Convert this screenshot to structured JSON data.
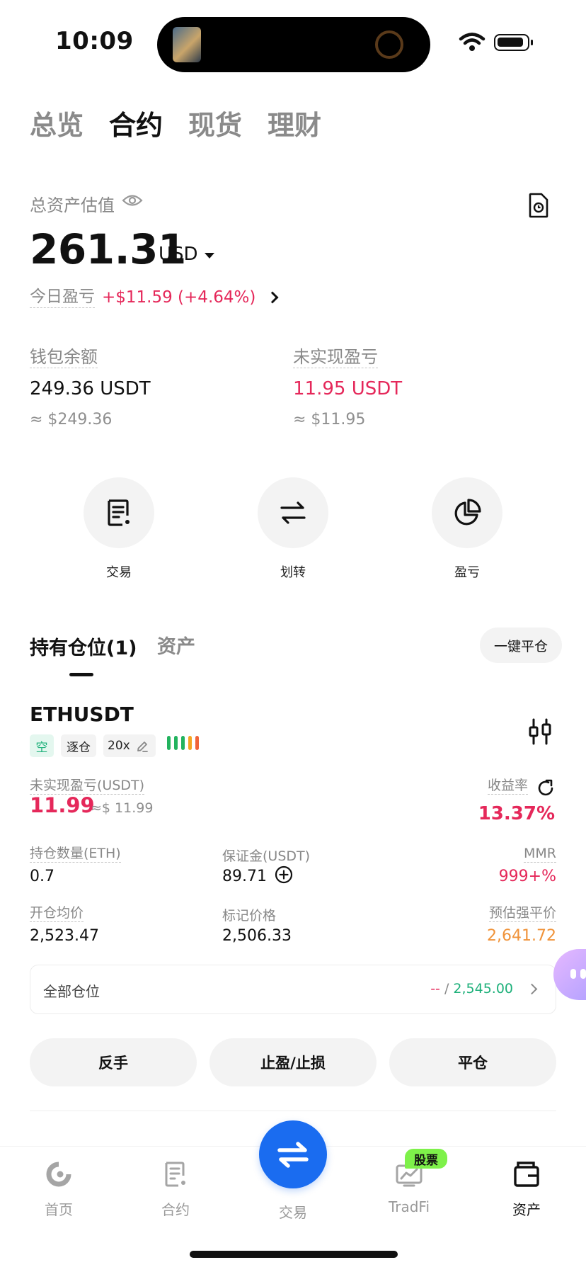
{
  "status_bar": {
    "time": "10:09"
  },
  "top_tabs": [
    {
      "label": "总览",
      "active": false
    },
    {
      "label": "合约",
      "active": true
    },
    {
      "label": "现货",
      "active": false
    },
    {
      "label": "理财",
      "active": false
    }
  ],
  "summary": {
    "label": "总资产估值",
    "value": "261.31",
    "unit": "USD",
    "today_pnl_label": "今日盈亏",
    "today_pnl_value": "+$11.59 (+4.64%)"
  },
  "wallet": {
    "label": "钱包余额",
    "value": "249.36 USDT",
    "approx": "≈ $249.36"
  },
  "unrealized": {
    "label": "未实现盈亏",
    "value": "11.95 USDT",
    "approx": "≈ $11.95"
  },
  "actions": [
    {
      "label": "交易",
      "icon": "trade-note-icon"
    },
    {
      "label": "划转",
      "icon": "transfer-arrows-icon"
    },
    {
      "label": "盈亏",
      "icon": "pie-chart-icon"
    }
  ],
  "positions_tabs": {
    "holding": "持有仓位(1)",
    "assets": "资产",
    "close_all": "一键平仓"
  },
  "position": {
    "symbol": "ETHUSDT",
    "side_tag": "空",
    "margin_mode_tag": "逐仓",
    "leverage_tag": "20x",
    "risk_bar_colors": [
      "#22b35e",
      "#22b35e",
      "#22b35e",
      "#f5a623",
      "#f0643a"
    ],
    "unrealized_label": "未实现盈亏(USDT)",
    "unrealized_value": "11.99",
    "unrealized_approx": "≈$ 11.99",
    "roi_label": "收益率",
    "roi_value": "13.37%",
    "size_label": "持仓数量(ETH)",
    "size_value": "0.7",
    "margin_label": "保证金(USDT)",
    "margin_value": "89.71",
    "mmr_label": "MMR",
    "mmr_value": "999+%",
    "entry_label": "开仓均价",
    "entry_value": "2,523.47",
    "mark_label": "标记价格",
    "mark_value": "2,506.33",
    "liq_label": "预估强平价",
    "liq_value": "2,641.72",
    "all_positions_label": "全部仓位",
    "all_positions_dash": "--",
    "all_positions_sep": " / ",
    "all_positions_price": "2,545.00",
    "buttons": [
      "反手",
      "止盈/止损",
      "平仓"
    ]
  },
  "bottom_nav": {
    "home": "首页",
    "futures": "合约",
    "trade": "交易",
    "tradfi": "TradFi",
    "tradfi_badge": "股票",
    "assets": "资产"
  },
  "colors": {
    "red": "#e5285a",
    "green": "#1db07a",
    "orange": "#f0933a",
    "blue": "#1a6cf0"
  }
}
